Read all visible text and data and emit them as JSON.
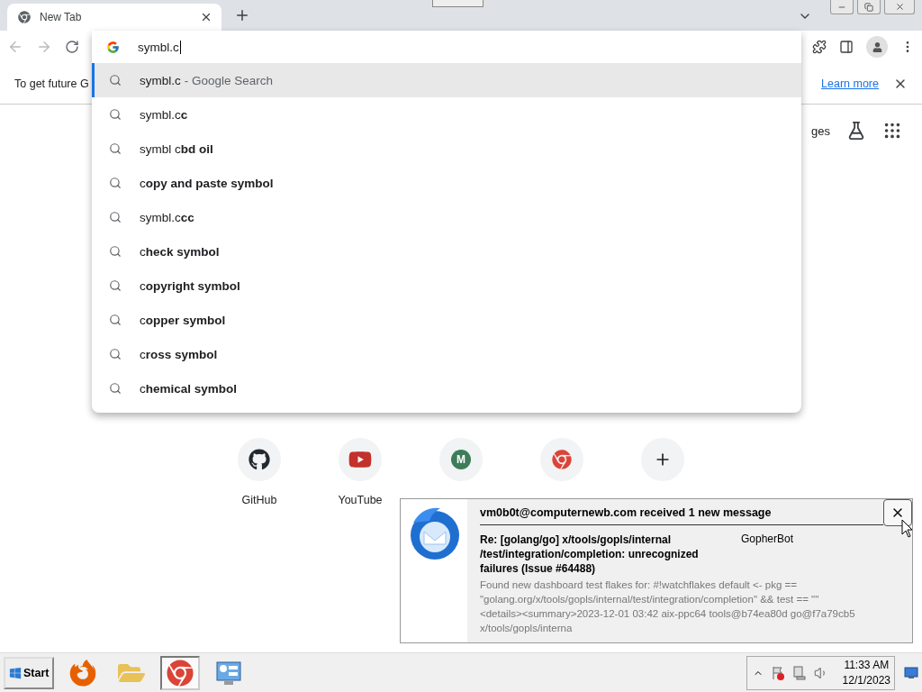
{
  "tabs": [
    {
      "title": "New Tab",
      "selected": true
    }
  ],
  "omnibox": {
    "value": "symbl.c"
  },
  "suggestions": [
    {
      "text": "symbl.c",
      "suffix": "- Google Search",
      "selected": true
    },
    {
      "text": "symbl.c**c**",
      "selected": false
    },
    {
      "text": "symbl c**bd oil**",
      "selected": false
    },
    {
      "text": "c**opy and paste symbol**",
      "selected": false
    },
    {
      "text": "symbl.c**cc**",
      "selected": false
    },
    {
      "text": "c**heck symbol**",
      "selected": false
    },
    {
      "text": "c**opyright symbol**",
      "selected": false
    },
    {
      "text": "c**opper symbol**",
      "selected": false
    },
    {
      "text": "c**ross symbol**",
      "selected": false
    },
    {
      "text": "c**hemical symbol**",
      "selected": false
    }
  ],
  "infobar": {
    "message": "To get future G",
    "link": "Learn more"
  },
  "header": {
    "link": "ges"
  },
  "shortcuts": [
    {
      "kind": "github",
      "label": "GitHub"
    },
    {
      "kind": "youtube",
      "label": "YouTube"
    },
    {
      "kind": "letter",
      "letter": "M"
    },
    {
      "kind": "chrome"
    },
    {
      "kind": "add"
    }
  ],
  "notification": {
    "title": "vm0b0t@computernewb.com received 1 new message",
    "subject": "Re: [golang/go] x/tools/gopls/internal /test/integration/completion: unrecognized failures (Issue #64488)",
    "sender": "GopherBot",
    "preview": "Found new dashboard test flakes for: #!watchflakes default <- pkg == \"golang.org/x/tools/gopls/internal/test/integration/completion\" && test == \"\" <details><summary>2023-12-01 03:42 aix-ppc64 tools@b74ea80d go@f7a79cb5 x/tools/gopls/interna"
  },
  "taskbar": {
    "start": "Start",
    "apps": [
      {
        "kind": "firefox",
        "active": false
      },
      {
        "kind": "explorer",
        "active": false
      },
      {
        "kind": "chrome",
        "active": true
      },
      {
        "kind": "control",
        "active": false
      }
    ],
    "time": "11:33 AM",
    "date": "12/1/2023"
  }
}
